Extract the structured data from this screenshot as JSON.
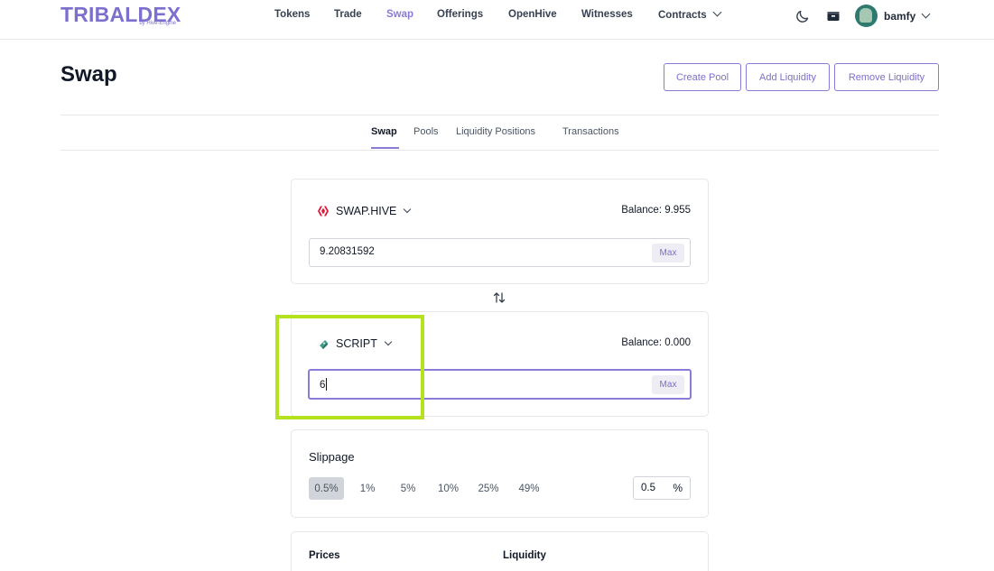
{
  "brand": {
    "logo_text": "TRIBALDEX",
    "logo_sub": "by Hive-Engine"
  },
  "nav": {
    "items": [
      {
        "label": "Tokens"
      },
      {
        "label": "Trade"
      },
      {
        "label": "Swap",
        "active": true
      },
      {
        "label": "Offerings"
      },
      {
        "label": "OpenHive"
      },
      {
        "label": "Witnesses"
      },
      {
        "label": "Contracts"
      }
    ]
  },
  "user": {
    "name": "bamfy"
  },
  "header": {
    "title": "Swap",
    "create_pool": "Create Pool",
    "add_liquidity": "Add Liquidity",
    "remove_liquidity": "Remove Liquidity"
  },
  "tabs": [
    {
      "label": "Swap",
      "active": true
    },
    {
      "label": "Pools"
    },
    {
      "label": "Liquidity Positions"
    },
    {
      "label": "Transactions"
    }
  ],
  "from": {
    "token": "SWAP.HIVE",
    "balance": "Balance: 9.955",
    "amount": "9.20831592",
    "max_label": "Max"
  },
  "to": {
    "token": "SCRIPT",
    "balance": "Balance: 0.000",
    "amount": "6",
    "max_label": "Max"
  },
  "slippage": {
    "title": "Slippage",
    "options": [
      "0.5%",
      "1%",
      "5%",
      "10%",
      "25%",
      "49%"
    ],
    "selected": "0.5%",
    "custom_value": "0.5",
    "unit": "%"
  },
  "info": {
    "prices_label": "Prices",
    "liquidity_label": "Liquidity"
  },
  "colors": {
    "accent": "#8b7ad8",
    "highlight": "#b4e21e",
    "hive_red": "#e31337"
  }
}
